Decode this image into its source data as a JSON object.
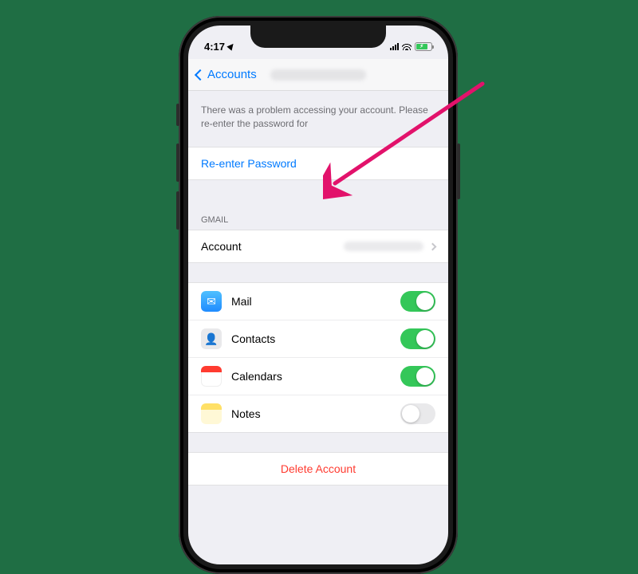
{
  "status_bar": {
    "time": "4:17",
    "battery_charging": true
  },
  "nav": {
    "back_label": "Accounts"
  },
  "alert": {
    "message": "There was a problem accessing your account. Please re-enter the password for"
  },
  "reenter": {
    "label": "Re-enter Password"
  },
  "sections": {
    "gmail_header": "GMAIL"
  },
  "account_row": {
    "label": "Account"
  },
  "services": [
    {
      "key": "mail",
      "label": "Mail",
      "enabled": true
    },
    {
      "key": "contacts",
      "label": "Contacts",
      "enabled": true
    },
    {
      "key": "calendars",
      "label": "Calendars",
      "enabled": true
    },
    {
      "key": "notes",
      "label": "Notes",
      "enabled": false
    }
  ],
  "delete": {
    "label": "Delete Account"
  },
  "colors": {
    "link": "#007aff",
    "destructive": "#ff3b30",
    "toggle_on": "#34c759",
    "background": "#efeff4"
  },
  "annotation": {
    "type": "arrow",
    "color": "#e2126b",
    "target": "reenter-password-row"
  }
}
